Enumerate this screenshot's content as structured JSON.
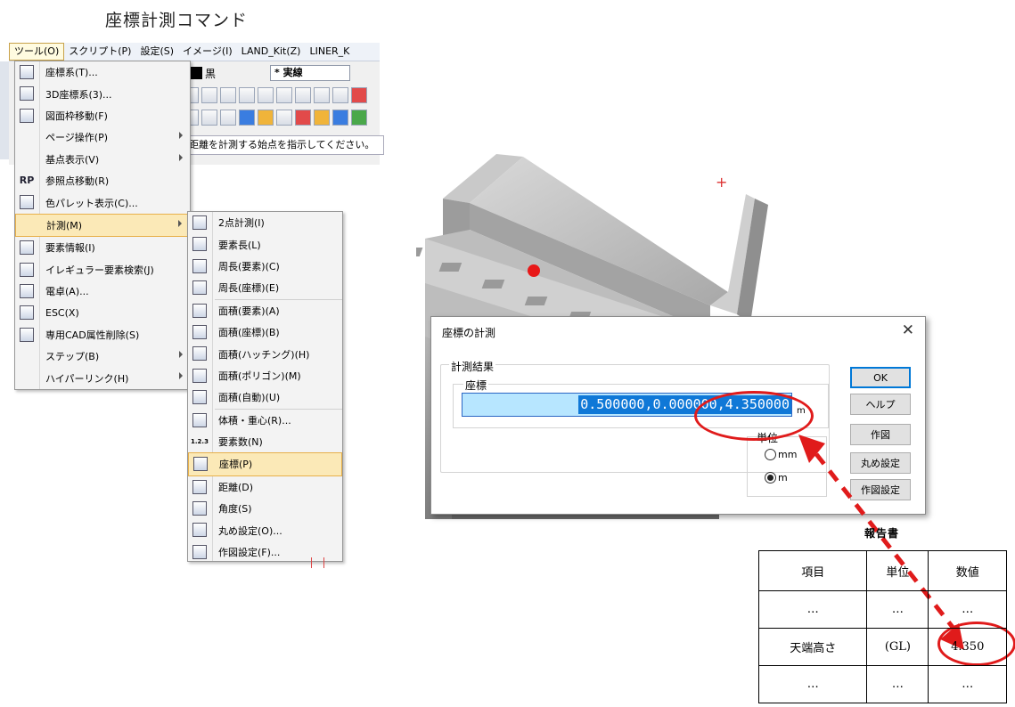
{
  "page_title": "座標計測コマンド",
  "menubar": [
    "ツール(O)",
    "スクリプト(P)",
    "設定(S)",
    "イメージ(I)",
    "LAND_Kit(Z)",
    "LINER_K"
  ],
  "toolbar": {
    "color_label": "黒",
    "linetype": "* 実線",
    "prompt": "距離を計測する始点を指示してください。"
  },
  "tools_menu": [
    {
      "label": "座標系(T)...",
      "icon": "axes-icon"
    },
    {
      "label": "3D座標系(3)...",
      "icon": "axes3d-icon"
    },
    {
      "label": "図面枠移動(F)",
      "icon": "frame-icon"
    },
    {
      "label": "ページ操作(P)",
      "icon": "",
      "submenu": true
    },
    {
      "label": "基点表示(V)",
      "icon": "",
      "submenu": true
    },
    {
      "label": "参照点移動(R)",
      "icon": "rp-icon",
      "icon_text": "RP"
    },
    {
      "label": "色パレット表示(C)...",
      "icon": "palette-icon"
    },
    {
      "label": "計測(M)",
      "icon": "",
      "submenu": true,
      "highlight": true
    },
    {
      "label": "要素情報(I)",
      "icon": "info-icon"
    },
    {
      "label": "イレギュラー要素検索(J)",
      "icon": "search-icon"
    },
    {
      "label": "電卓(A)...",
      "icon": "calculator-icon"
    },
    {
      "label": "ESC(X)",
      "icon": "esc-icon"
    },
    {
      "label": "専用CAD属性削除(S)",
      "icon": "delete-attr-icon"
    },
    {
      "label": "ステップ(B)",
      "icon": "",
      "submenu": true
    },
    {
      "label": "ハイパーリンク(H)",
      "icon": "",
      "submenu": true
    }
  ],
  "measure_menu": [
    {
      "label": "2点計測(I)",
      "icon": "two-point-icon"
    },
    {
      "label": "要素長(L)",
      "icon": "length-icon"
    },
    {
      "label": "周長(要素)(C)",
      "icon": "perimeter-icon"
    },
    {
      "label": "周長(座標)(E)",
      "icon": "perimeter-coord-icon"
    },
    {
      "label": "面積(要素)(A)",
      "icon": "area-icon"
    },
    {
      "label": "面積(座標)(B)",
      "icon": "area-coord-icon"
    },
    {
      "label": "面積(ハッチング)(H)",
      "icon": "area-hatch-icon"
    },
    {
      "label": "面積(ポリゴン)(M)",
      "icon": "area-polygon-icon"
    },
    {
      "label": "面積(自動)(U)",
      "icon": "area-auto-icon"
    },
    {
      "label": "体積・重心(R)...",
      "icon": "volume-icon"
    },
    {
      "label": "要素数(N)",
      "icon": "count-icon",
      "icon_text": "1.2.3"
    },
    {
      "label": "座標(P)",
      "icon": "coordinate-icon",
      "highlight": true
    },
    {
      "label": "距離(D)",
      "icon": "distance-icon"
    },
    {
      "label": "角度(S)",
      "icon": "angle-icon"
    },
    {
      "label": "丸め設定(O)...",
      "icon": "round-icon"
    },
    {
      "label": "作図設定(F)...",
      "icon": "draw-settings-icon"
    }
  ],
  "dialog": {
    "title": "座標の計測",
    "group_label": "計測結果",
    "coord_label": "座標",
    "coord_value": "0.500000,0.000000,4.350000",
    "coord_unit": "m",
    "unit_label": "単位",
    "radio_mm": "mm",
    "radio_m": "m",
    "buttons": {
      "ok": "OK",
      "help": "ヘルプ",
      "draw": "作図",
      "round": "丸め設定",
      "draw_settings": "作図設定"
    }
  },
  "report": {
    "title": "報告書",
    "headers": [
      "項目",
      "単位",
      "数値"
    ],
    "rows": [
      [
        "…",
        "…",
        "…"
      ],
      [
        "天端高さ",
        "(GL)",
        "4.350"
      ],
      [
        "…",
        "…",
        "…"
      ]
    ]
  },
  "colors": {
    "highlight_red": "#e01b1b",
    "selection_blue": "#0f78d7",
    "input_bg": "#b7e6ff"
  }
}
